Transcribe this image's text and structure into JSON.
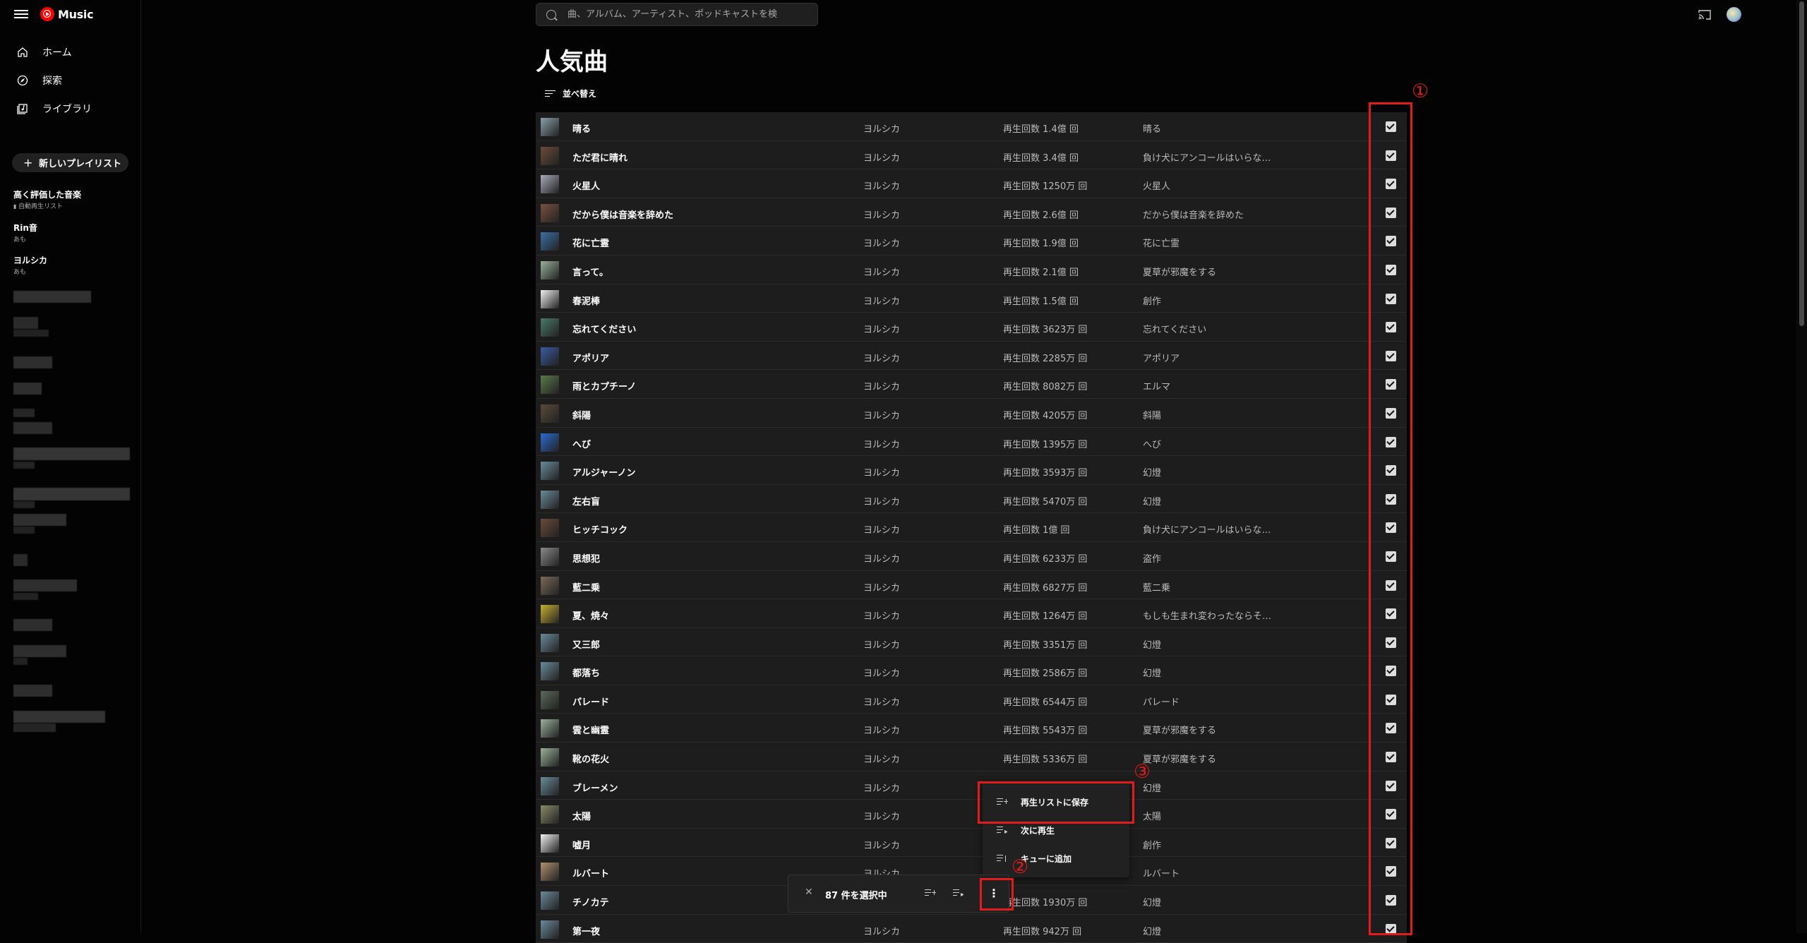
{
  "app": {
    "logo_text": "Music"
  },
  "search": {
    "placeholder": "曲、アルバム、アーティスト、ポッドキャストを検"
  },
  "nav": [
    {
      "label": "ホーム",
      "icon": "home-icon"
    },
    {
      "label": "探索",
      "icon": "compass-icon"
    },
    {
      "label": "ライブラリ",
      "icon": "library-icon"
    }
  ],
  "new_playlist_label": "新しいプレイリスト",
  "playlists": [
    {
      "title": "高く評価した音楽",
      "subtitle": "自動再生リスト"
    },
    {
      "title": "Rin音",
      "subtitle": "あも"
    },
    {
      "title": "ヨルシカ",
      "subtitle": "あも"
    }
  ],
  "page": {
    "title": "人気曲",
    "sort_label": "並べ替え"
  },
  "tracks": [
    {
      "title": "晴る",
      "artist": "ヨルシカ",
      "plays": "再生回数 1.4億 回",
      "album": "晴る",
      "color": "#8aa0a8",
      "checked": true
    },
    {
      "title": "ただ君に晴れ",
      "artist": "ヨルシカ",
      "plays": "再生回数 3.4億 回",
      "album": "負け犬にアンコールはいらな…",
      "color": "#6b4a3a",
      "checked": true
    },
    {
      "title": "火星人",
      "artist": "ヨルシカ",
      "plays": "再生回数 1250万 回",
      "album": "火星人",
      "color": "#a9a9b8",
      "checked": true
    },
    {
      "title": "だから僕は音楽を辞めた",
      "artist": "ヨルシカ",
      "plays": "再生回数 2.6億 回",
      "album": "だから僕は音楽を辞めた",
      "color": "#7a5040",
      "checked": true
    },
    {
      "title": "花に亡霊",
      "artist": "ヨルシカ",
      "plays": "再生回数 1.9億 回",
      "album": "花に亡霊",
      "color": "#3d6fa8",
      "checked": true
    },
    {
      "title": "言って。",
      "artist": "ヨルシカ",
      "plays": "再生回数 2.1億 回",
      "album": "夏草が邪魔をする",
      "color": "#9ab09a",
      "checked": true
    },
    {
      "title": "春泥棒",
      "artist": "ヨルシカ",
      "plays": "再生回数 1.5億 回",
      "album": "創作",
      "color": "#f0f0f0",
      "checked": true
    },
    {
      "title": "忘れてください",
      "artist": "ヨルシカ",
      "plays": "再生回数 3623万 回",
      "album": "忘れてください",
      "color": "#4a7a6a",
      "checked": true
    },
    {
      "title": "アポリア",
      "artist": "ヨルシカ",
      "plays": "再生回数 2285万 回",
      "album": "アポリア",
      "color": "#3a5aa0",
      "checked": true
    },
    {
      "title": "雨とカプチーノ",
      "artist": "ヨルシカ",
      "plays": "再生回数 8082万 回",
      "album": "エルマ",
      "color": "#5a7a4a",
      "checked": true
    },
    {
      "title": "斜陽",
      "artist": "ヨルシカ",
      "plays": "再生回数 4205万 回",
      "album": "斜陽",
      "color": "#5a4a3a",
      "checked": true
    },
    {
      "title": "へび",
      "artist": "ヨルシカ",
      "plays": "再生回数 1395万 回",
      "album": "へび",
      "color": "#2a6ad0",
      "checked": true
    },
    {
      "title": "アルジャーノン",
      "artist": "ヨルシカ",
      "plays": "再生回数 3593万 回",
      "album": "幻燈",
      "color": "#6a8a9a",
      "checked": true
    },
    {
      "title": "左右盲",
      "artist": "ヨルシカ",
      "plays": "再生回数 5470万 回",
      "album": "幻燈",
      "color": "#6a8a9a",
      "checked": true
    },
    {
      "title": "ヒッチコック",
      "artist": "ヨルシカ",
      "plays": "再生回数 1億 回",
      "album": "負け犬にアンコールはいらな…",
      "color": "#6b4a3a",
      "checked": true
    },
    {
      "title": "思想犯",
      "artist": "ヨルシカ",
      "plays": "再生回数 6233万 回",
      "album": "盗作",
      "color": "#8a8a8a",
      "checked": true
    },
    {
      "title": "藍二乗",
      "artist": "ヨルシカ",
      "plays": "再生回数 6827万 回",
      "album": "藍二乗",
      "color": "#7a6a5a",
      "checked": true
    },
    {
      "title": "夏、焼々",
      "artist": "ヨルシカ",
      "plays": "再生回数 1264万 回",
      "album": "もしも生まれ変わったならそ…",
      "color": "#c8b030",
      "checked": true
    },
    {
      "title": "又三郎",
      "artist": "ヨルシカ",
      "plays": "再生回数 3351万 回",
      "album": "幻燈",
      "color": "#6a8a9a",
      "checked": true
    },
    {
      "title": "都落ち",
      "artist": "ヨルシカ",
      "plays": "再生回数 2586万 回",
      "album": "幻燈",
      "color": "#6a8a9a",
      "checked": true
    },
    {
      "title": "パレード",
      "artist": "ヨルシカ",
      "plays": "再生回数 6544万 回",
      "album": "パレード",
      "color": "#5a6a5a",
      "checked": true
    },
    {
      "title": "雲と幽霊",
      "artist": "ヨルシカ",
      "plays": "再生回数 5543万 回",
      "album": "夏草が邪魔をする",
      "color": "#9ab09a",
      "checked": true
    },
    {
      "title": "靴の花火",
      "artist": "ヨルシカ",
      "plays": "再生回数 5336万 回",
      "album": "夏草が邪魔をする",
      "color": "#9ab09a",
      "checked": true
    },
    {
      "title": "ブレーメン",
      "artist": "ヨルシカ",
      "plays": "",
      "album": "幻燈",
      "color": "#6a8a9a",
      "checked": true
    },
    {
      "title": "太陽",
      "artist": "ヨルシカ",
      "plays": "",
      "album": "太陽",
      "color": "#8a8a6a",
      "checked": true
    },
    {
      "title": "嘘月",
      "artist": "ヨルシカ",
      "plays": "",
      "album": "創作",
      "color": "#f0f0f0",
      "checked": true
    },
    {
      "title": "ルバート",
      "artist": "ヨルシカ",
      "plays": "",
      "album": "ルバート",
      "color": "#b09070",
      "checked": true
    },
    {
      "title": "チノカテ",
      "artist": "ヨルシカ",
      "plays": "再生回数 1930万 回",
      "album": "幻燈",
      "color": "#6a8a9a",
      "checked": true
    },
    {
      "title": "第一夜",
      "artist": "ヨルシカ",
      "plays": "再生回数 942万 回",
      "album": "幻燈",
      "color": "#6a8a9a",
      "checked": true
    }
  ],
  "context_menu": [
    {
      "label": "再生リストに保存",
      "icon": "playlist-add-icon"
    },
    {
      "label": "次に再生",
      "icon": "play-next-icon"
    },
    {
      "label": "キューに追加",
      "icon": "queue-add-icon"
    }
  ],
  "selection": {
    "count_label": "87 件を選択中"
  },
  "annotations": {
    "n1": "①",
    "n2": "②",
    "n3": "③"
  },
  "colors": {
    "background": "#030303",
    "row": "#1d1d1d",
    "annotation": "#e21b1b",
    "brand": "#ff0000"
  }
}
